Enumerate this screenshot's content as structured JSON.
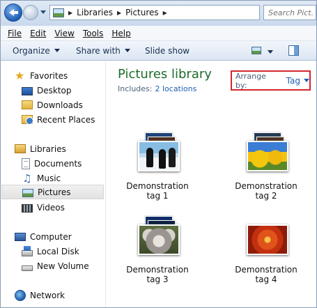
{
  "address": {
    "crumbs": [
      "Libraries",
      "Pictures"
    ],
    "search_placeholder": "Search Pict..."
  },
  "menu": [
    "File",
    "Edit",
    "View",
    "Tools",
    "Help"
  ],
  "commands": {
    "organize": "Organize",
    "share_with": "Share with",
    "slide_show": "Slide show"
  },
  "nav": {
    "favorites": "Favorites",
    "desktop": "Desktop",
    "downloads": "Downloads",
    "recent_places": "Recent Places",
    "libraries": "Libraries",
    "documents": "Documents",
    "music": "Music",
    "pictures": "Pictures",
    "videos": "Videos",
    "computer": "Computer",
    "local_disk": "Local Disk",
    "new_volume": "New Volume",
    "network": "Network",
    "selected": "Pictures"
  },
  "library": {
    "title": "Pictures library",
    "includes_label": "Includes:",
    "locations": "2 locations",
    "arrange_label": "Arrange by:",
    "arrange_value": "Tag"
  },
  "tiles": [
    {
      "line1": "Demonstration",
      "line2": "tag 1",
      "image": "penguins"
    },
    {
      "line1": "Demonstration",
      "line2": "tag 2",
      "image": "tulips"
    },
    {
      "line1": "Demonstration",
      "line2": "tag 3",
      "image": "koala"
    },
    {
      "line1": "Demonstration",
      "line2": "tag 4",
      "image": "flower"
    }
  ],
  "colors": {
    "library_title": "#1e6c2c",
    "link": "#1d5fb5",
    "highlight_box": "#d4262e"
  }
}
